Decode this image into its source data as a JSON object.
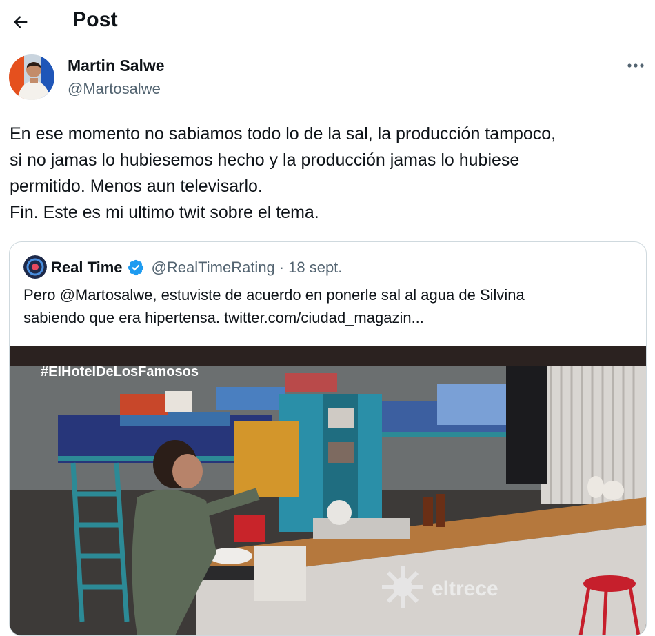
{
  "header": {
    "title": "Post",
    "back_icon": "arrow-left-icon"
  },
  "author": {
    "name": "Martin Salwe",
    "handle": "@Martosalwe"
  },
  "more_icon": "more-horizontal-icon",
  "post": {
    "lines": [
      "En ese momento no sabiamos todo lo de la sal, la producción tampoco,",
      "si no jamas lo hubiesemos hecho y la producción jamas lo hubiese",
      "permitido. Menos aun televisarlo.",
      "Fin. Este es mi ultimo twit sobre el tema."
    ]
  },
  "quote": {
    "name": "Real Time",
    "verified_icon": "verified-badge-icon",
    "handle": "@RealTimeRating",
    "separator": "·",
    "date": "18 sept.",
    "lines": [
      "Pero @Martosalwe, estuviste de acuerdo en ponerle sal al agua de Silvina",
      "sabiendo que era hipertensa.  twitter.com/ciudad_magazin..."
    ],
    "media": {
      "hashtag": "#ElHotelDeLosFamosos",
      "watermark": "eltrece"
    }
  },
  "colors": {
    "text": "#0f1419",
    "secondary": "#536471",
    "border": "#cfd9de",
    "verified": "#1d9bf0"
  }
}
